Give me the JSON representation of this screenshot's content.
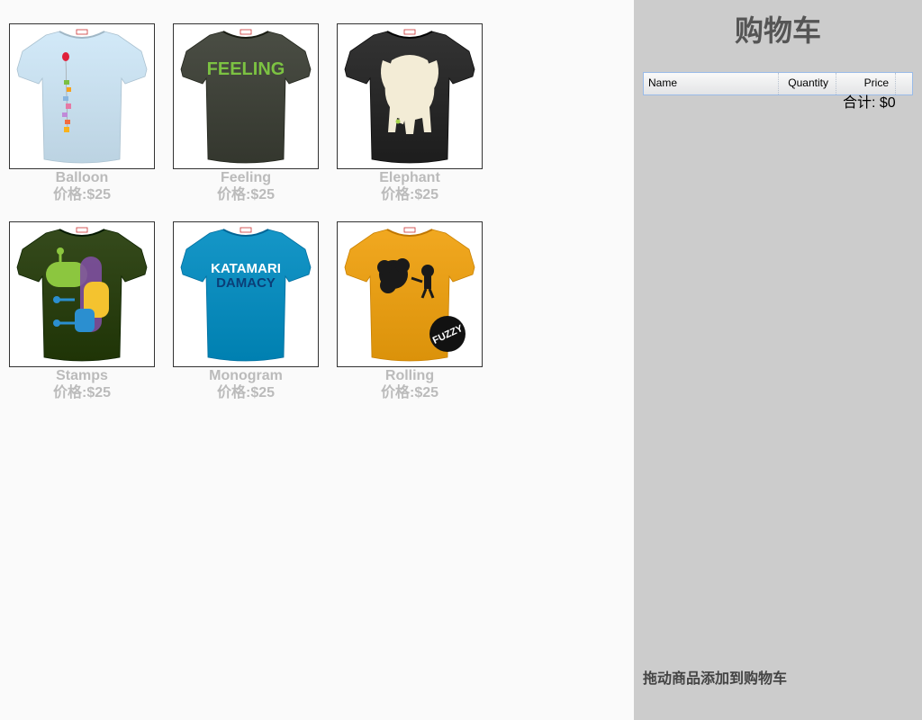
{
  "products": [
    {
      "name": "Balloon",
      "price": "价格:$25",
      "shirt_color": "#d2e9f8",
      "design": "balloon"
    },
    {
      "name": "Feeling",
      "price": "价格:$25",
      "shirt_color": "#4a4d44",
      "design": "feeling",
      "design_text": "FEELING"
    },
    {
      "name": "Elephant",
      "price": "价格:$25",
      "shirt_color": "#333333",
      "design": "elephant"
    },
    {
      "name": "Stamps",
      "price": "价格:$25",
      "shirt_color": "#354a1c",
      "design": "stamps"
    },
    {
      "name": "Monogram",
      "price": "价格:$25",
      "shirt_color": "#1596c7",
      "design": "monogram",
      "design_text": [
        "KATAMARI",
        "DAMACY"
      ]
    },
    {
      "name": "Rolling",
      "price": "价格:$25",
      "shirt_color": "#f1a820",
      "design": "rolling",
      "design_text": "FUZZY"
    }
  ],
  "cart": {
    "title": "购物车",
    "columns": {
      "name": "Name",
      "quantity": "Quantity",
      "price": "Price"
    },
    "total_label": "合计:",
    "total_value": "$0",
    "hint": "拖动商品添加到购物车"
  },
  "colors": {
    "cart_background": "#cccccc",
    "page_background": "#fafafa",
    "label_color": "#bbbbbb"
  }
}
